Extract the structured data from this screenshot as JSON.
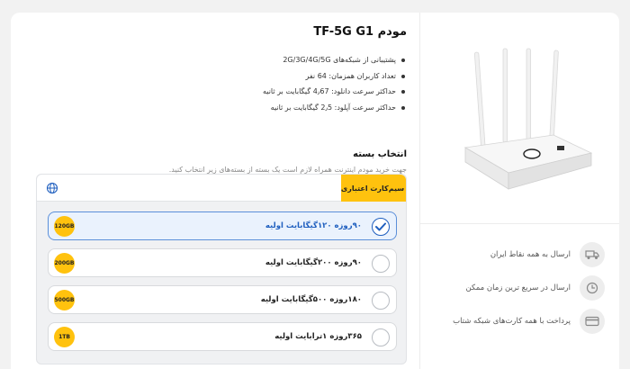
{
  "product": {
    "title": "مودم TF-5G G1",
    "specs": [
      "پشتیبانی از شبکه‌های 2G/3G/4G/5G",
      "تعداد کاربران همزمان: 64 نفر",
      "حداکثر سرعت دانلود: 4٫67 گیگابایت بر ثانیه",
      "حداکثر سرعت آپلود: 2٫5 گیگابایت بر ثانیه"
    ]
  },
  "packages": {
    "heading": "انتخاب بسته",
    "description": "جهت خرید مودم اینترنت همراه لازم است یک بسته از بسته‌های زیر انتخاب کنید.",
    "tab_label": "سیم‌کارت اعتباری",
    "options": [
      {
        "label": "۹۰روزه ۱۲۰گیگابایت اولیه",
        "badge": "120GB",
        "selected": true
      },
      {
        "label": "۹۰روزه ۲۰۰گیگابایت اولیه",
        "badge": "200GB",
        "selected": false
      },
      {
        "label": "۱۸۰روزه ۵۰۰گیگابایت اولیه",
        "badge": "500GB",
        "selected": false
      },
      {
        "label": "۳۶۵روزه ۱ترابایت اولیه",
        "badge": "1TB",
        "selected": false
      }
    ]
  },
  "features": [
    {
      "label": "ارسال به همه نقاط ایران",
      "icon": "truck-icon"
    },
    {
      "label": "ارسال در سریع ترین زمان ممکن",
      "icon": "clock-icon"
    },
    {
      "label": "پرداخت با همه کارت‌های شبکه شتاب",
      "icon": "credit-card-icon"
    }
  ],
  "colors": {
    "accent": "#ffc20e",
    "selected": "#1f5fbf"
  }
}
